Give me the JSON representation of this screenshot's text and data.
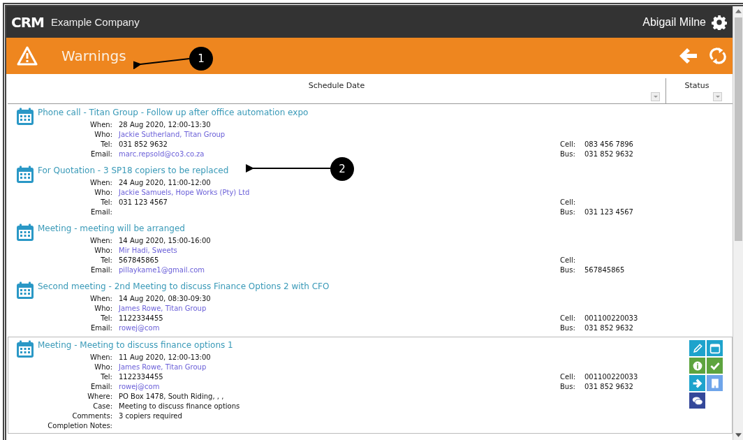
{
  "app": {
    "logo": "CRM",
    "company": "Example Company",
    "user": "Abigail Milne"
  },
  "page": {
    "title": "Warnings"
  },
  "table": {
    "columns": [
      "Schedule Date",
      "Status"
    ]
  },
  "activities": [
    {
      "title": "Phone call - Titan Group - Follow up after office automation expo",
      "selected": false,
      "details": [
        {
          "label": "When:",
          "value": "28 Aug 2020, 12:00-13:30",
          "kind": "text"
        },
        {
          "label": "Who:",
          "value": "Jackie Sutherland, Titan Group",
          "kind": "link"
        },
        {
          "label": "Tel:",
          "value": "031 852 9632",
          "kind": "text"
        },
        {
          "label": "Email:",
          "value": "marc.repsold@co3.co.za",
          "kind": "link"
        }
      ],
      "phones": [
        {
          "label": "Cell:",
          "value": "083 456 7896"
        },
        {
          "label": "Bus:",
          "value": "031 852 9632"
        }
      ]
    },
    {
      "title": "For Quotation - 3 SP18 copiers to be replaced",
      "selected": false,
      "details": [
        {
          "label": "When:",
          "value": "24 Aug 2020, 11:00-12:00",
          "kind": "text"
        },
        {
          "label": "Who:",
          "value": "Jackie Samuels, Hope Works (Pty) Ltd",
          "kind": "link"
        },
        {
          "label": "Tel:",
          "value": "031 123 4567",
          "kind": "text"
        },
        {
          "label": "Email:"
        }
      ],
      "phones": [
        {
          "label": "Cell:"
        },
        {
          "label": "Bus:",
          "value": "031 123 4567"
        }
      ]
    },
    {
      "title": "Meeting - meeting will be arranged",
      "selected": false,
      "details": [
        {
          "label": "When:",
          "value": "14 Aug 2020, 15:00-16:00",
          "kind": "text"
        },
        {
          "label": "Who:",
          "value": "Mir Hadi, Sweets",
          "kind": "link"
        },
        {
          "label": "Tel:",
          "value": "567845865",
          "kind": "text"
        },
        {
          "label": "Email:",
          "value": "pillaykame1@gmail.com",
          "kind": "link"
        }
      ],
      "phones": [
        {
          "label": "Cell:"
        },
        {
          "label": "Bus:",
          "value": "567845865"
        }
      ]
    },
    {
      "title": "Second meeting - 2nd Meeting to discuss Finance Options 2 with CFO",
      "selected": false,
      "details": [
        {
          "label": "When:",
          "value": "14 Aug 2020, 08:30-09:30",
          "kind": "text"
        },
        {
          "label": "Who:",
          "value": "James Rowe, Titan Group",
          "kind": "link"
        },
        {
          "label": "Tel:",
          "value": "1122334455",
          "kind": "text"
        },
        {
          "label": "Email:",
          "value": "rowej@com",
          "kind": "link"
        }
      ],
      "phones": [
        {
          "label": "Cell:",
          "value": "001100220033"
        },
        {
          "label": "Bus:",
          "value": "031 852 9632"
        }
      ]
    },
    {
      "title": "Meeting - Meeting to discuss finance options 1",
      "selected": true,
      "details": [
        {
          "label": "When:",
          "value": "11 Aug 2020, 12:00-13:00",
          "kind": "text"
        },
        {
          "label": "Who:",
          "value": "James Rowe, Titan Group",
          "kind": "link"
        },
        {
          "label": "Tel:",
          "value": "1122334455",
          "kind": "text"
        },
        {
          "label": "Email:",
          "value": "rowej@com",
          "kind": "link"
        },
        {
          "label": "Where:",
          "value": "PO Box 1478, South Riding, , ,",
          "kind": "text"
        },
        {
          "label": "Case:",
          "value": "Meeting to discuss finance options",
          "kind": "text"
        },
        {
          "label": "Comments:",
          "value": "3 copiers required",
          "kind": "text"
        },
        {
          "label": "Completion Notes:"
        }
      ],
      "phones": [
        {
          "label": "Cell:",
          "value": "001100220033"
        },
        {
          "label": "Bus:",
          "value": "031 852 9632"
        }
      ]
    }
  ],
  "row_actions": [
    {
      "kind": "edit"
    },
    {
      "kind": "calendar"
    },
    {
      "kind": "info"
    },
    {
      "kind": "complete"
    },
    {
      "kind": "forward"
    },
    {
      "kind": "company"
    },
    {
      "kind": "comment"
    }
  ],
  "callouts": [
    {
      "label": "1"
    },
    {
      "label": "2"
    }
  ]
}
